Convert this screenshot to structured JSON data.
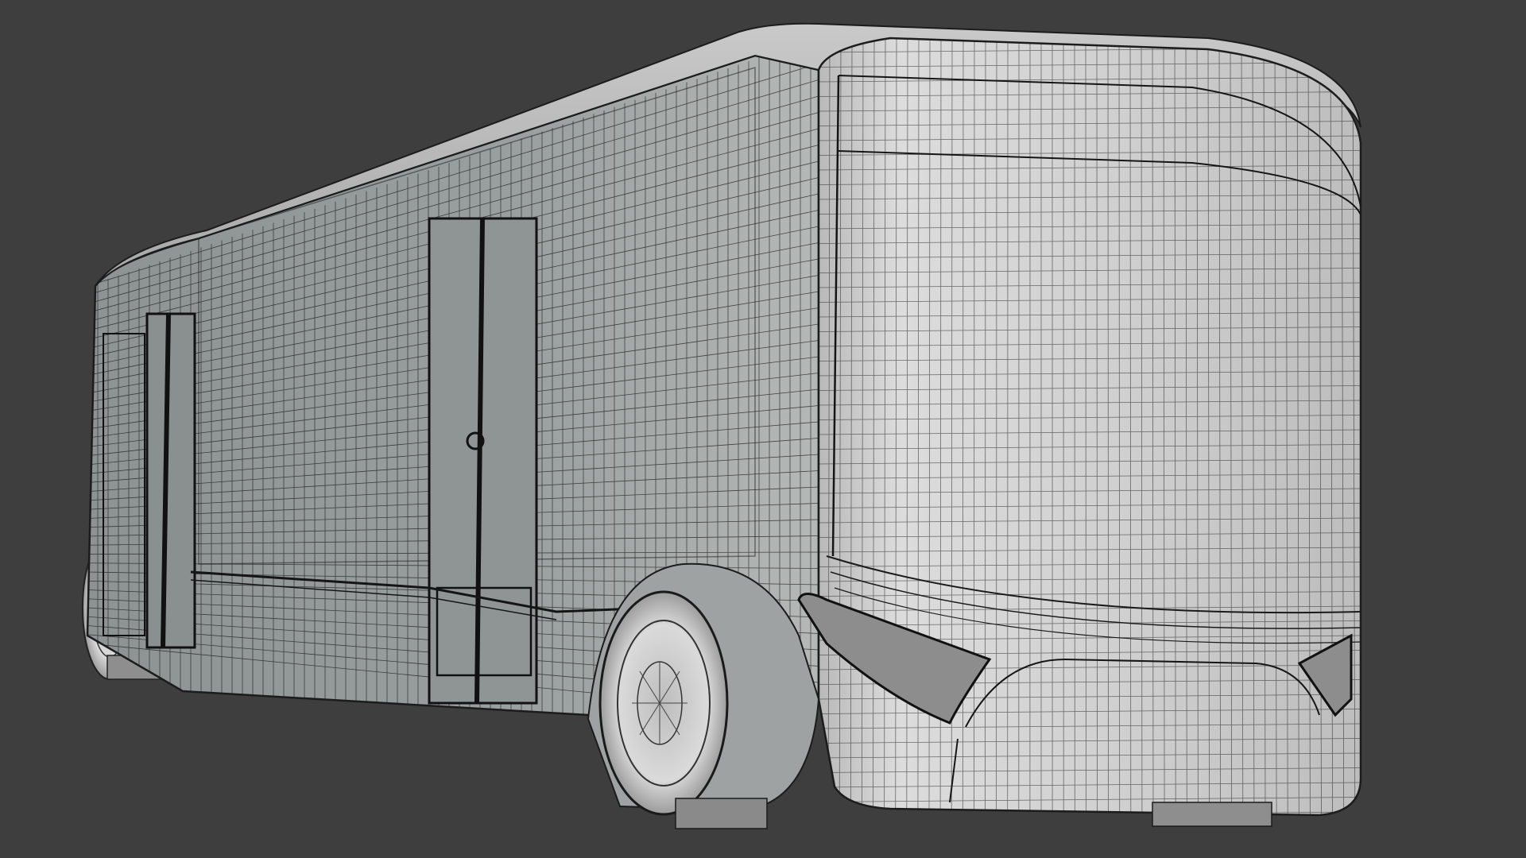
{
  "viewport": {
    "background_color": "#3e3e3e"
  },
  "model": {
    "subject": "bus",
    "shading": "solid-with-wireframe",
    "body_color": "#9a9a9a",
    "highlight_color": "#d4d4d4",
    "wire_color": "#1e1e1e",
    "tire_color": "#cfcfcf"
  }
}
